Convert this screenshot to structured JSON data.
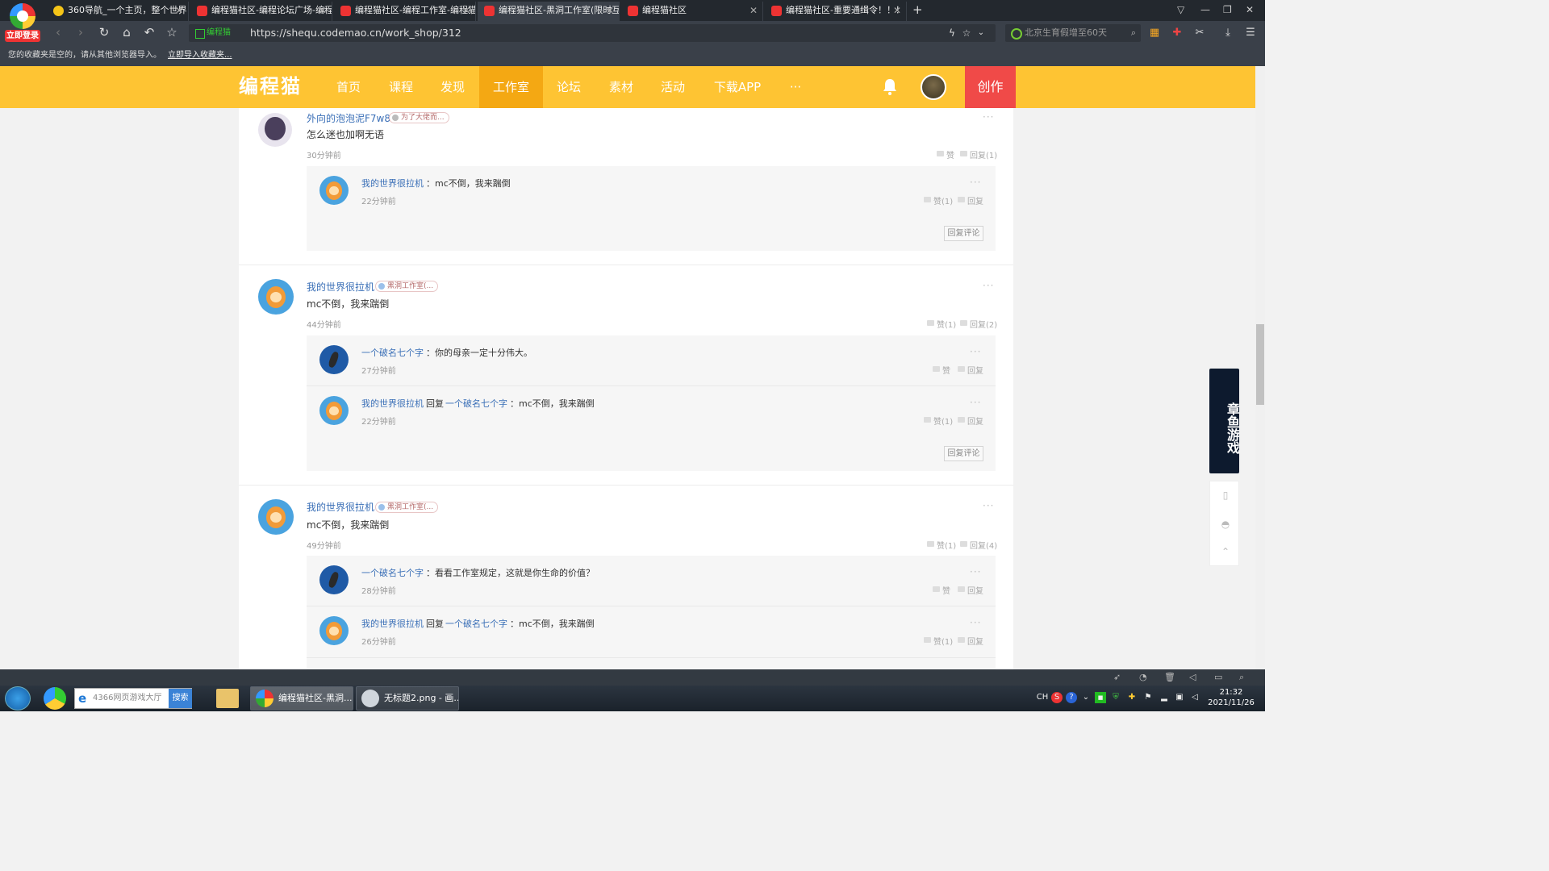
{
  "browser": {
    "login_badge": "立即登录",
    "tabs": [
      {
        "title": "360导航_一个主页，整个世界",
        "active": false
      },
      {
        "title": "编程猫社区-编程论坛广场-编程猫",
        "active": false
      },
      {
        "title": "编程猫社区-编程工作室-编程猫",
        "active": false
      },
      {
        "title": "编程猫社区-黑洞工作室(限时互",
        "active": true
      },
      {
        "title": "编程猫社区",
        "active": false
      },
      {
        "title": "编程猫社区-重要通缉令！！！",
        "active": false
      }
    ],
    "new_tab": "+",
    "secure_label": "编程猫",
    "url": "https://shequ.codemao.cn/work_shop/312",
    "search_text": "北京生育假增至60天",
    "bookmark_hint": "您的收藏夹是空的，请从其他浏览器导入。",
    "bookmark_import": "立即导入收藏夹..."
  },
  "site": {
    "logo": "编程猫",
    "nav": [
      "首页",
      "课程",
      "发现",
      "工作室",
      "论坛",
      "素材",
      "活动",
      "下载APP",
      "···"
    ],
    "active_nav": "工作室",
    "create_label": "创作"
  },
  "comments": [
    {
      "author": "外向的泡泡泥F7w8",
      "badge": "为了大佬而...",
      "text": "怎么迷也加啊无语",
      "time": "30分钟前",
      "like": "赞",
      "reply": "回复(1)",
      "replies": [
        {
          "author": "我的世界很拉机",
          "reply_to": "",
          "text": "：mc不倒，我来踹倒",
          "time": "22分钟前",
          "like": "赞(1)",
          "reply": "回复"
        }
      ],
      "reply_button": "回复评论"
    },
    {
      "author": "我的世界很拉机",
      "badge": "黑洞工作室(...",
      "text": "mc不倒，我来踹倒",
      "time": "44分钟前",
      "like": "赞(1)",
      "reply": "回复(2)",
      "replies": [
        {
          "author": "一个破名七个字",
          "reply_to": "",
          "text": "：你的母亲一定十分伟大。",
          "time": "27分钟前",
          "like": "赞",
          "reply": "回复"
        },
        {
          "author": "我的世界很拉机",
          "reply_word": "回复",
          "reply_to": "一个破名七个字",
          "text": "：mc不倒，我来踹倒",
          "time": "22分钟前",
          "like": "赞(1)",
          "reply": "回复"
        }
      ],
      "reply_button": "回复评论"
    },
    {
      "author": "我的世界很拉机",
      "badge": "黑洞工作室(...",
      "text": "mc不倒，我来踹倒",
      "time": "49分钟前",
      "like": "赞(1)",
      "reply": "回复(4)",
      "replies": [
        {
          "author": "一个破名七个字",
          "reply_to": "",
          "text": "：看看工作室规定，这就是你生命的价值？",
          "time": "28分钟前",
          "like": "赞",
          "reply": "回复"
        },
        {
          "author": "我的世界很拉机",
          "reply_word": "回复",
          "reply_to": "一个破名七个字",
          "text": "：mc不倒，我来踹倒",
          "time": "26分钟前",
          "like": "赞(1)",
          "reply": "回复"
        }
      ]
    }
  ],
  "side_ad": "章鱼游戏",
  "more_icon": "···",
  "taskbar": {
    "search_text": "4366网页游戏大厅",
    "search_button": "搜索",
    "tasks": [
      "编程猫社区-黑洞...",
      "无标题2.png - 画..."
    ],
    "ime": "CH",
    "time": "21:32",
    "date": "2021/11/26"
  }
}
